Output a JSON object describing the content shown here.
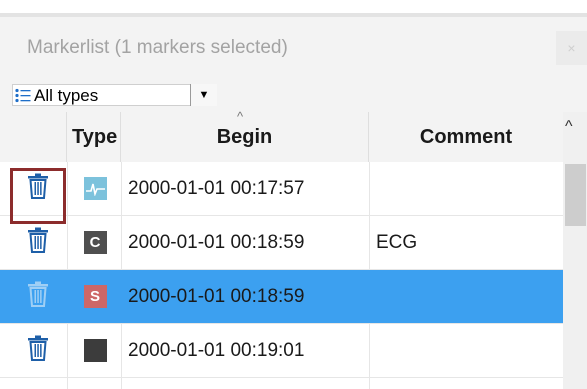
{
  "panel": {
    "title": "Markerlist (1 markers selected)",
    "close_glyph": "×"
  },
  "filter": {
    "icon": "list-icon",
    "selected": "All types",
    "dropdown_glyph": "▼"
  },
  "columns": {
    "type": "Type",
    "begin": "Begin",
    "comment": "Comment",
    "sort_glyph": "^"
  },
  "rows": [
    {
      "begin": "2000-01-01 00:17:57",
      "comment": "",
      "badge_icon": "ecg-waveform-icon",
      "badge_color": "#7cc2dc",
      "badge_text": "",
      "selected": false
    },
    {
      "begin": "2000-01-01 00:18:59",
      "comment": "ECG",
      "badge_icon": "c-badge-icon",
      "badge_color": "#4f4f4f",
      "badge_text": "C",
      "selected": false
    },
    {
      "begin": "2000-01-01 00:18:59",
      "comment": "",
      "badge_icon": "s-badge-icon",
      "badge_color": "#cd6767",
      "badge_text": "S",
      "selected": true
    },
    {
      "begin": "2000-01-01 00:19:01",
      "comment": "",
      "badge_icon": "dark-square-icon",
      "badge_color": "#3c3c3c",
      "badge_text": "",
      "selected": false
    }
  ],
  "colors": {
    "selection": "#3ca0f0",
    "trash_icon": "#1e5fa8",
    "highlight_border": "#8c2c2c"
  },
  "scrollbar": {
    "up_glyph": "^"
  }
}
